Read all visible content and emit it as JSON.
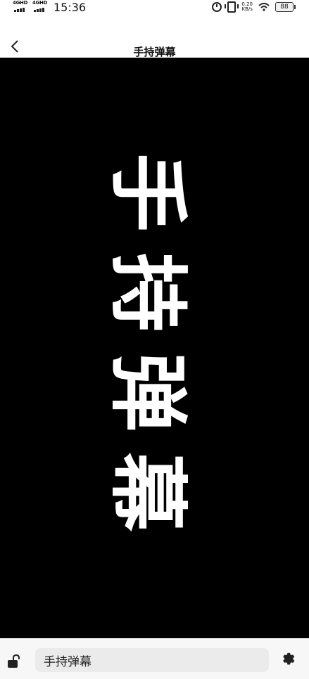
{
  "status_bar": {
    "sim1_label": "4GHD",
    "sim2_label": "4GHD",
    "time": "15:36",
    "net_speed_value": "0.20",
    "net_speed_unit": "KB/s",
    "battery": "88"
  },
  "header": {
    "title": "手持弹幕",
    "back_icon": "chevron-left-icon"
  },
  "display": {
    "text": "手持弹幕",
    "background": "#000000",
    "text_color": "#ffffff",
    "orientation": "vertical"
  },
  "bottom_bar": {
    "input_value": "手持弹幕",
    "lock_icon": "unlock-icon",
    "settings_icon": "gear-icon"
  }
}
